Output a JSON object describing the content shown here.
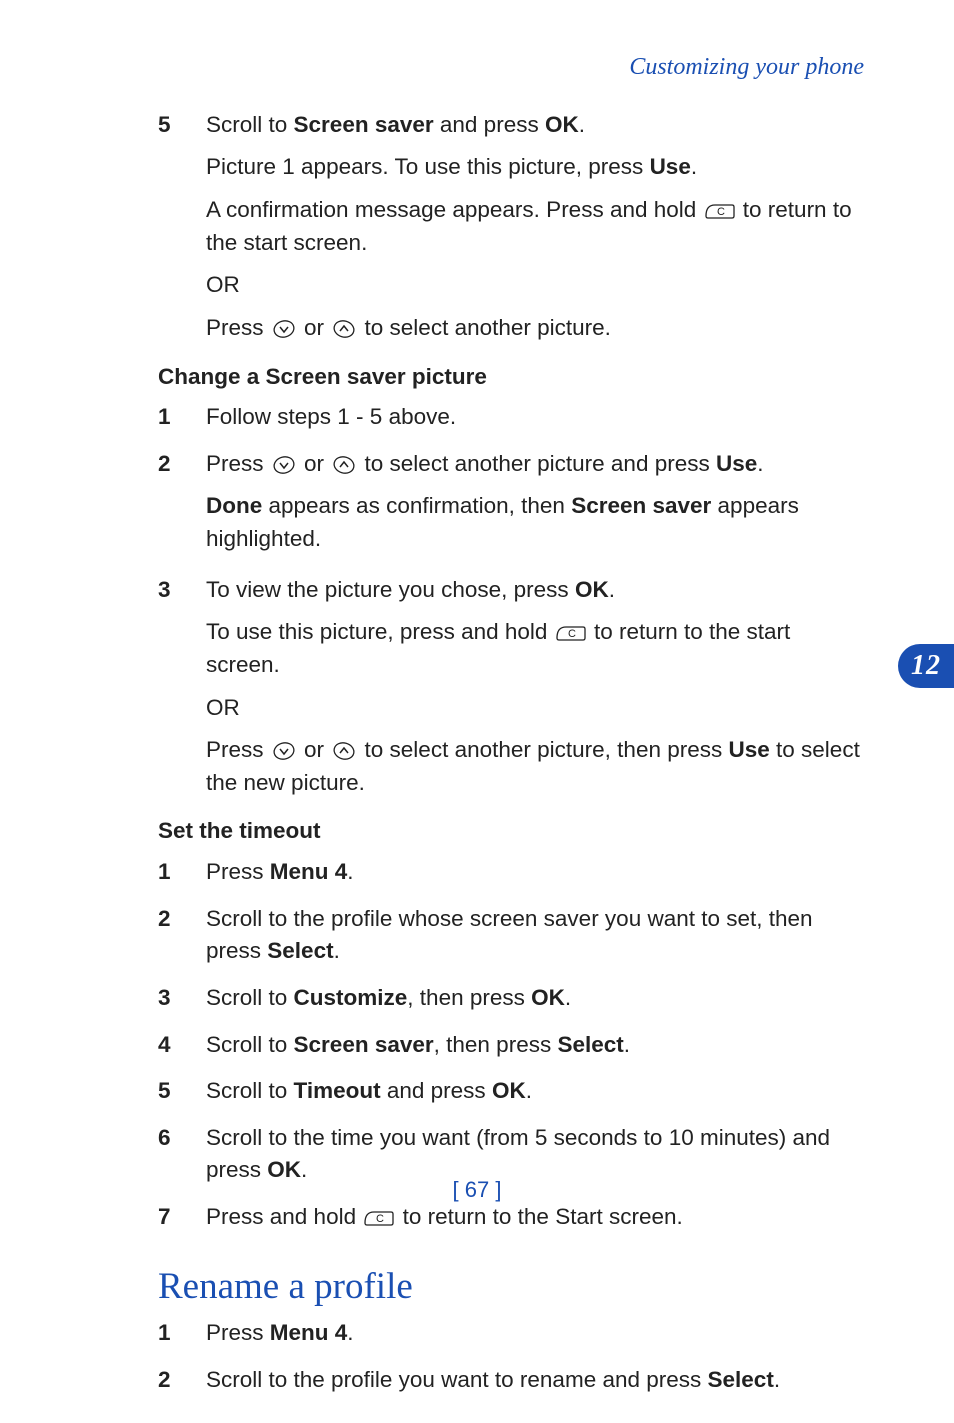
{
  "header": "Customizing your phone",
  "section1": {
    "step5": {
      "num": "5",
      "line1_a": "Scroll to ",
      "line1_b": "Screen saver",
      "line1_c": " and press ",
      "line1_d": "OK",
      "line1_e": ".",
      "para1_a": "Picture 1 appears. To use this picture, press ",
      "para1_b": "Use",
      "para1_c": ".",
      "para2_a": "A confirmation message appears. Press and hold ",
      "para2_b": " to return to the start screen.",
      "para3": "OR",
      "para4_a": "Press ",
      "para4_b": " or ",
      "para4_c": " to select another picture."
    }
  },
  "section2": {
    "heading": "Change a Screen saver picture",
    "step1": {
      "num": "1",
      "text": "Follow steps 1 - 5 above."
    },
    "step2": {
      "num": "2",
      "line1_a": "Press ",
      "line1_b": " or ",
      "line1_c": " to select another picture and press ",
      "line1_d": "Use",
      "line1_e": ".",
      "para1_a": "Done",
      "para1_b": " appears as confirmation, then ",
      "para1_c": "Screen saver",
      "para1_d": " appears highlighted."
    },
    "step3": {
      "num": "3",
      "line1_a": "To view the picture you chose, press ",
      "line1_b": "OK",
      "line1_c": ".",
      "para1_a": "To use this picture, press and hold ",
      "para1_b": " to return to the start screen.",
      "para2": "OR",
      "para3_a": "Press ",
      "para3_b": " or ",
      "para3_c": " to select another picture, then press ",
      "para3_d": "Use",
      "para3_e": " to select the new picture."
    }
  },
  "section3": {
    "heading": "Set the timeout",
    "step1": {
      "num": "1",
      "text_a": "Press ",
      "text_b": "Menu 4",
      "text_c": "."
    },
    "step2": {
      "num": "2",
      "text_a": "Scroll to the profile whose screen saver you want to set, then press ",
      "text_b": "Select",
      "text_c": "."
    },
    "step3": {
      "num": "3",
      "text_a": "Scroll to ",
      "text_b": "Customize",
      "text_c": ", then press ",
      "text_d": "OK",
      "text_e": "."
    },
    "step4": {
      "num": "4",
      "text_a": "Scroll to ",
      "text_b": "Screen saver",
      "text_c": ", then press ",
      "text_d": "Select",
      "text_e": "."
    },
    "step5": {
      "num": "5",
      "text_a": "Scroll to ",
      "text_b": "Timeout",
      "text_c": " and press ",
      "text_d": "OK",
      "text_e": "."
    },
    "step6": {
      "num": "6",
      "text_a": "Scroll to the time you want (from 5 seconds to 10 minutes) and press ",
      "text_b": "OK",
      "text_c": "."
    },
    "step7": {
      "num": "7",
      "text_a": "Press and hold ",
      "text_b": " to return to the Start screen."
    }
  },
  "section4": {
    "heading": "Rename a profile",
    "step1": {
      "num": "1",
      "text_a": "Press ",
      "text_b": "Menu 4",
      "text_c": "."
    },
    "step2": {
      "num": "2",
      "text_a": "Scroll to the profile you want to rename and press ",
      "text_b": "Select",
      "text_c": "."
    }
  },
  "sidetab": "12",
  "footer": "[ 67 ]",
  "icons": {
    "key_c": "C",
    "arrow_down": "down-arrow-key",
    "arrow_up": "up-arrow-key"
  }
}
